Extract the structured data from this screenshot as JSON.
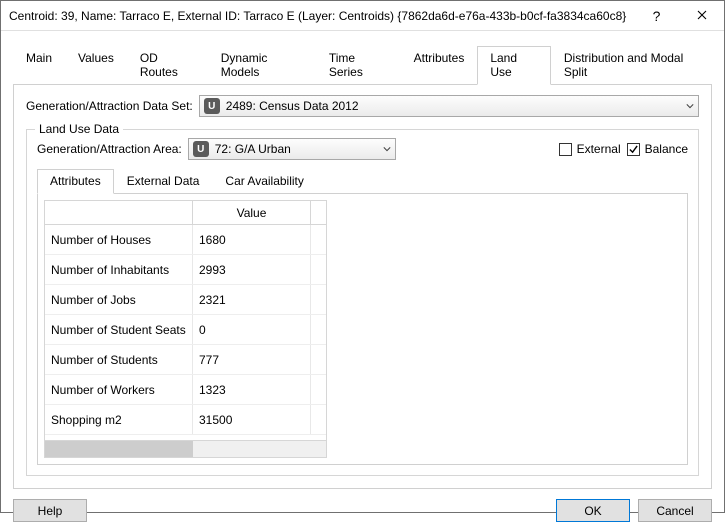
{
  "window": {
    "title": "Centroid: 39, Name: Tarraco E, External ID: Tarraco E (Layer: Centroids) {7862da6d-e76a-433b-b0cf-fa3834ca60c8}"
  },
  "tabs": {
    "main": [
      "Main",
      "Values",
      "OD Routes",
      "Dynamic Models",
      "Time Series",
      "Attributes",
      "Land Use",
      "Distribution and Modal Split"
    ],
    "active_main": "Land Use",
    "sub": [
      "Attributes",
      "External Data",
      "Car Availability"
    ],
    "active_sub": "Attributes"
  },
  "dataset": {
    "label": "Generation/Attraction Data Set:",
    "icon_glyph": "U",
    "value": "2489: Census Data 2012"
  },
  "groupbox": {
    "title": "Land Use Data",
    "area_label": "Generation/Attraction Area:",
    "area_icon_glyph": "U",
    "area_value": "72: G/A Urban",
    "external_label": "External",
    "external_checked": false,
    "balance_label": "Balance",
    "balance_checked": true
  },
  "table": {
    "header_value": "Value",
    "rows": [
      {
        "name": "Number of Houses",
        "value": "1680"
      },
      {
        "name": "Number of Inhabitants",
        "value": "2993"
      },
      {
        "name": "Number of Jobs",
        "value": "2321"
      },
      {
        "name": "Number of Student Seats",
        "value": "0"
      },
      {
        "name": "Number of Students",
        "value": "777"
      },
      {
        "name": "Number of Workers",
        "value": "1323"
      },
      {
        "name": "Shopping m2",
        "value": "31500"
      }
    ]
  },
  "footer": {
    "help": "Help",
    "ok": "OK",
    "cancel": "Cancel"
  }
}
